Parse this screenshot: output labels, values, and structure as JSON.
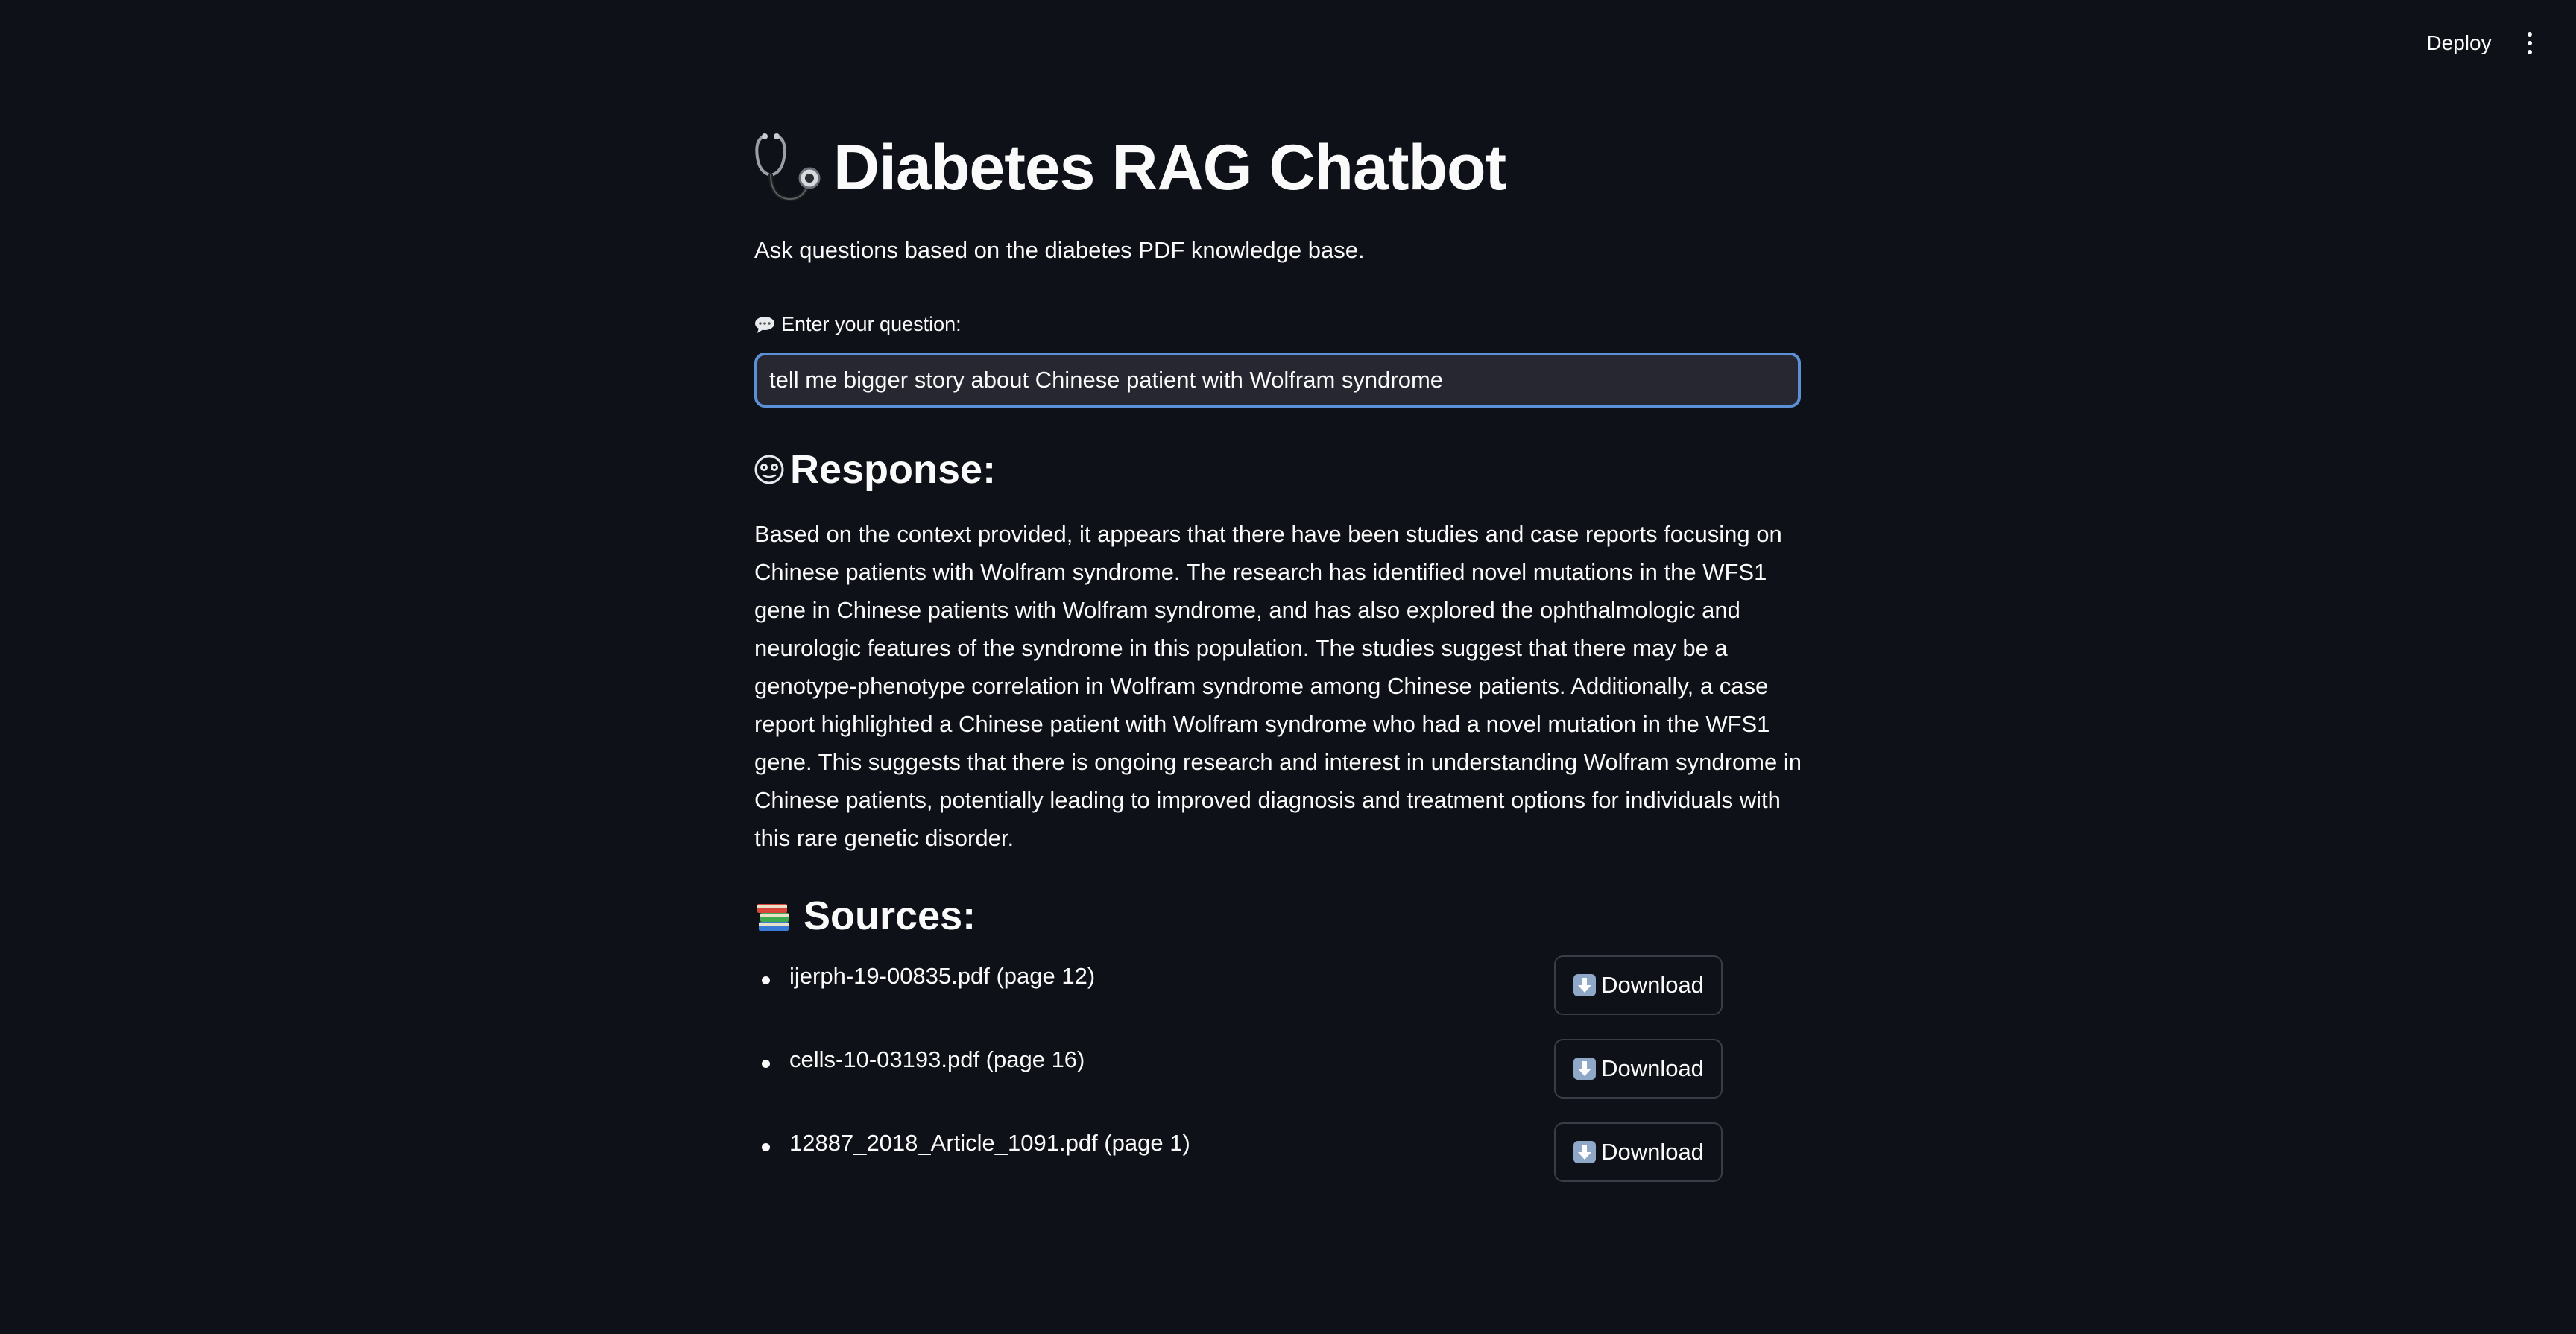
{
  "header": {
    "deploy_label": "Deploy",
    "menu_icon": "more-vertical-icon"
  },
  "main": {
    "title_icon": "stethoscope-icon",
    "title": "Diabetes RAG Chatbot",
    "subtitle": "Ask questions based on the diabetes PDF knowledge base.",
    "question": {
      "label_icon": "speech-bubble-icon",
      "label": "Enter your question:",
      "value": "tell me bigger story about Chinese patient with Wolfram syndrome"
    },
    "response": {
      "icon": "face-icon",
      "heading": "Response:",
      "text": "Based on the context provided, it appears that there have been studies and case reports focusing on Chinese patients with Wolfram syndrome. The research has identified novel mutations in the WFS1 gene in Chinese patients with Wolfram syndrome, and has also explored the ophthalmologic and neurologic features of the syndrome in this population. The studies suggest that there may be a genotype-phenotype correlation in Wolfram syndrome among Chinese patients. Additionally, a case report highlighted a Chinese patient with Wolfram syndrome who had a novel mutation in the WFS1 gene. This suggests that there is ongoing research and interest in understanding Wolfram syndrome in Chinese patients, potentially leading to improved diagnosis and treatment options for individuals with this rare genetic disorder."
    },
    "sources": {
      "icon": "books-icon",
      "heading": "Sources:",
      "items": [
        {
          "name": "ijerph-19-00835.pdf (page 12)",
          "download_label": "Download"
        },
        {
          "name": "cells-10-03193.pdf (page 16)",
          "download_label": "Download"
        },
        {
          "name": "12887_2018_Article_1091.pdf (page 1)",
          "download_label": "Download"
        }
      ]
    }
  },
  "colors": {
    "background": "#0e1117",
    "text": "#fafafa",
    "input_bg": "#262730",
    "input_focus_border": "#5b8fd6",
    "button_border": "#3a3d48"
  }
}
